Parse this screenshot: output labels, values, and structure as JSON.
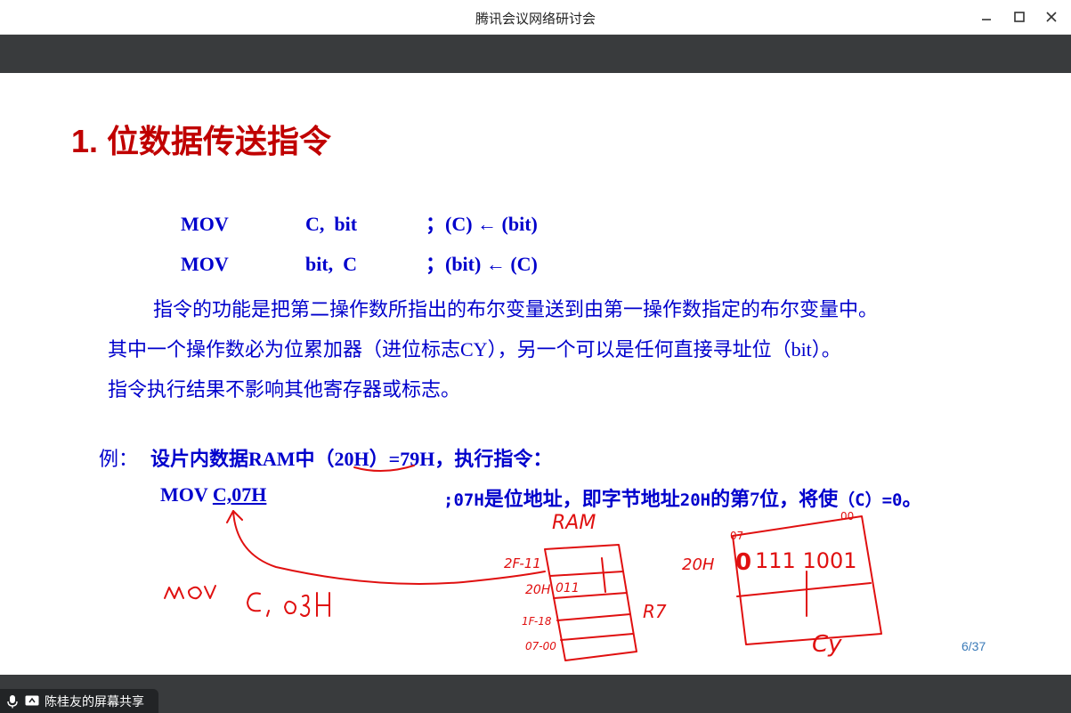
{
  "window": {
    "title": "腾讯会议网络研讨会"
  },
  "slide": {
    "heading": "1. 位数据传送指令",
    "instructions": [
      {
        "op": "MOV",
        "operands": "C,  bit",
        "comment": "；(C) ← (bit)"
      },
      {
        "op": "MOV",
        "operands": "bit,  C",
        "comment": "；(bit) ← (C)"
      }
    ],
    "description": [
      "指令的功能是把第二操作数所指出的布尔变量送到由第一操作数指定的布尔变量中。",
      "其中一个操作数必为位累加器（进位标志CY），另一个可以是任何直接寻址位（bit）。",
      "指令执行结果不影响其他寄存器或标志。"
    ],
    "example": {
      "label": "例：",
      "text_before": "设片内数据RAM中",
      "highlight": "（20H）",
      "text_after": "=79H，执行指令：",
      "instr_op": "MOV",
      "instr_operand": "C,07H",
      "instr_comment_code": ";07H",
      "instr_comment_a": "是位地址，即字节地址",
      "instr_comment_code2": "20H",
      "instr_comment_b": "的第7位，将使",
      "instr_comment_code3": "（C）=0",
      "instr_comment_end": "。"
    },
    "page_number": "6/37"
  },
  "status": {
    "share_label": "陈桂友的屏幕共享"
  },
  "colors": {
    "heading": "#c00000",
    "body": "#0000cc",
    "ink": "#e01010",
    "toolbar": "#393b3d"
  }
}
